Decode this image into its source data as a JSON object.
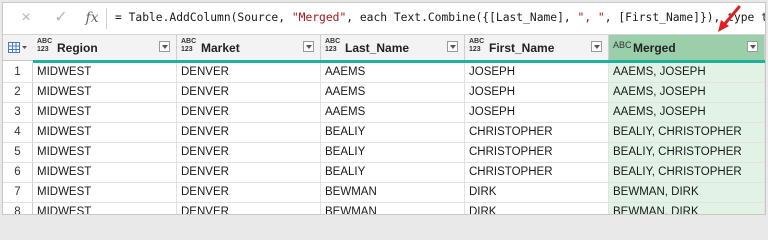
{
  "formula_bar": {
    "cancel_icon": "×",
    "commit_icon": "✓",
    "fx_label": "fx",
    "formula_parts": {
      "p1": "= Table.AddColumn(Source, ",
      "s1": "\"Merged\"",
      "p2": ", each Text.Combine({[Last_Name], ",
      "s2": "\", \"",
      "p3": ", [First_Name]}), type text)"
    }
  },
  "columns": [
    {
      "type_icon": "ABC\n123",
      "label": "Region"
    },
    {
      "type_icon": "ABC\n123",
      "label": "Market"
    },
    {
      "type_icon": "ABC\n123",
      "label": "Last_Name"
    },
    {
      "type_icon": "ABC\n123",
      "label": "First_Name"
    },
    {
      "type_icon": "A B C",
      "label": "Merged"
    }
  ],
  "rows": [
    {
      "n": "1",
      "cells": [
        "MIDWEST",
        "DENVER",
        "AAEMS",
        "JOSEPH",
        "AAEMS, JOSEPH"
      ]
    },
    {
      "n": "2",
      "cells": [
        "MIDWEST",
        "DENVER",
        "AAEMS",
        "JOSEPH",
        "AAEMS, JOSEPH"
      ]
    },
    {
      "n": "3",
      "cells": [
        "MIDWEST",
        "DENVER",
        "AAEMS",
        "JOSEPH",
        "AAEMS, JOSEPH"
      ]
    },
    {
      "n": "4",
      "cells": [
        "MIDWEST",
        "DENVER",
        "BEALIY",
        "CHRISTOPHER",
        "BEALIY, CHRISTOPHER"
      ]
    },
    {
      "n": "5",
      "cells": [
        "MIDWEST",
        "DENVER",
        "BEALIY",
        "CHRISTOPHER",
        "BEALIY, CHRISTOPHER"
      ]
    },
    {
      "n": "6",
      "cells": [
        "MIDWEST",
        "DENVER",
        "BEALIY",
        "CHRISTOPHER",
        "BEALIY, CHRISTOPHER"
      ]
    },
    {
      "n": "7",
      "cells": [
        "MIDWEST",
        "DENVER",
        "BEWMAN",
        "DIRK",
        "BEWMAN, DIRK"
      ]
    },
    {
      "n": "8",
      "cells": [
        "MIDWEST",
        "DENVER",
        "BEWMAN",
        "DIRK",
        "BEWMAN, DIRK"
      ]
    }
  ],
  "colors": {
    "selected_column": "#9bcfaa",
    "merged_cells": "#e2f3e6",
    "accent_bar": "#20b0a0",
    "annotation_arrow": "#e02020"
  },
  "icons": {
    "table_menu": "table-grid-icon",
    "annotation": "red-arrow-icon"
  }
}
